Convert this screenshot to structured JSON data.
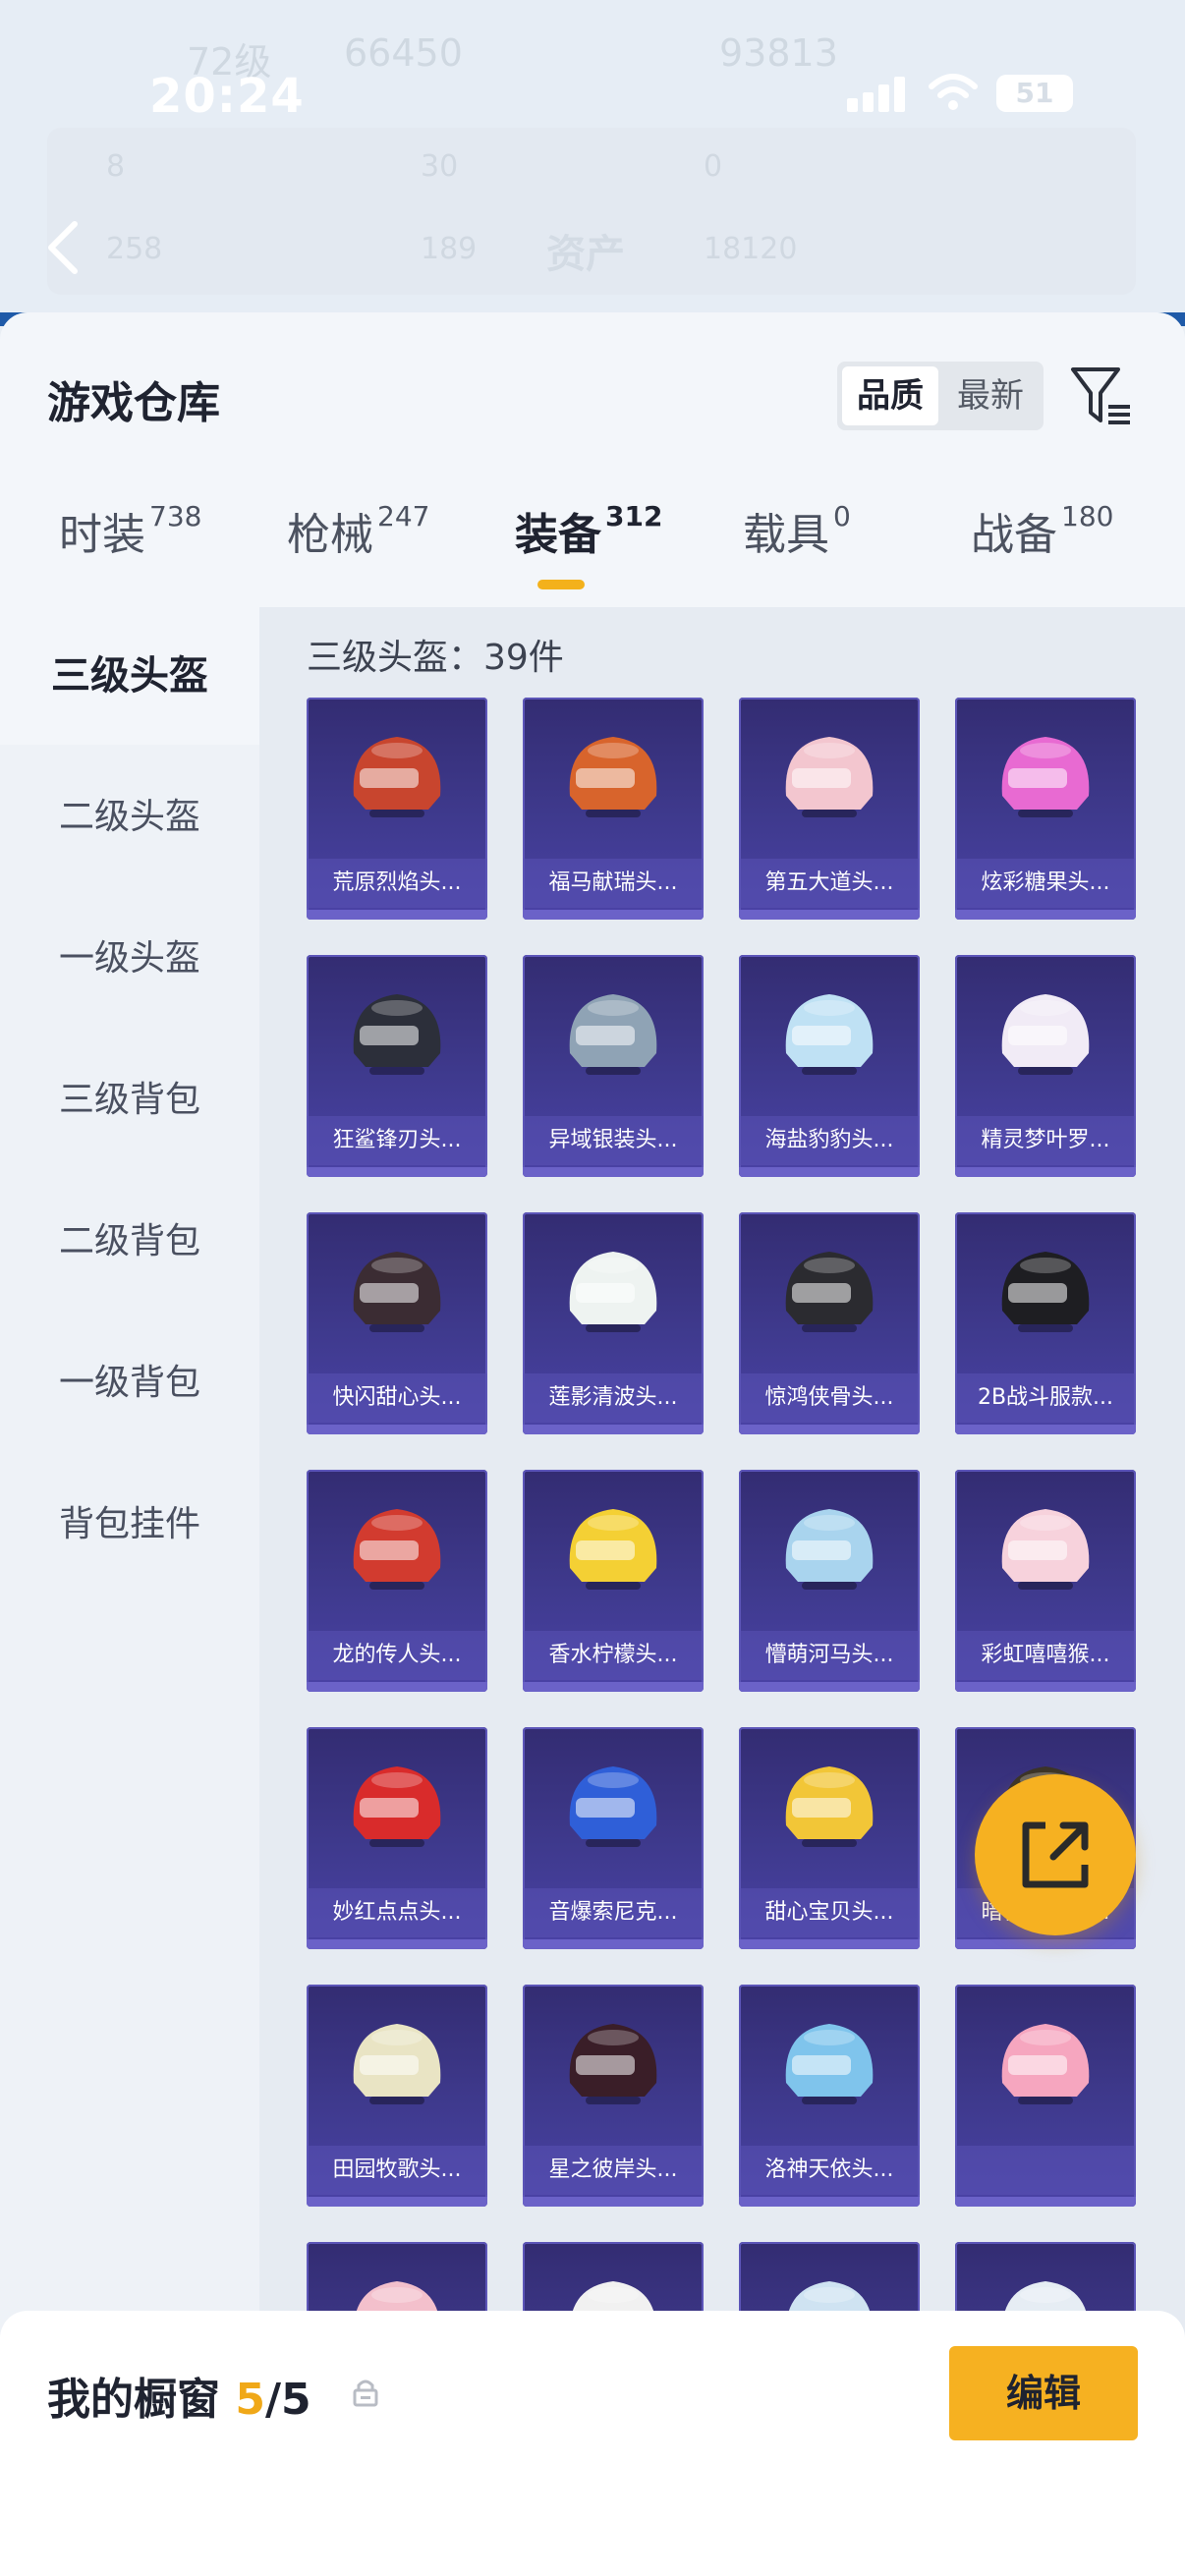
{
  "status_bar": {
    "time": "20:24",
    "battery": "51"
  },
  "background_header": {
    "level": "72级",
    "coins": "66450",
    "right_value": "93813",
    "stats_row1": [
      "8",
      "30",
      "0"
    ],
    "stats_row2": [
      "258",
      "189",
      "18120"
    ],
    "title": "资产"
  },
  "warehouse": {
    "title": "游戏仓库",
    "sort_options": [
      "品质",
      "最新"
    ],
    "tabs": [
      {
        "label": "时装",
        "count": "738"
      },
      {
        "label": "枪械",
        "count": "247"
      },
      {
        "label": "装备",
        "count": "312"
      },
      {
        "label": "载具",
        "count": "0"
      },
      {
        "label": "战备",
        "count": "180"
      }
    ],
    "sidebar": [
      "三级头盔",
      "二级头盔",
      "一级头盔",
      "三级背包",
      "二级背包",
      "一级背包",
      "背包挂件"
    ],
    "count_label": "三级头盔：39件",
    "items": [
      {
        "name": "荒原烈焰头...",
        "color": "#c8452e"
      },
      {
        "name": "福马献瑞头...",
        "color": "#d8642c"
      },
      {
        "name": "第五大道头...",
        "color": "#f3c6cf"
      },
      {
        "name": "炫彩糖果头...",
        "color": "#e86ad2"
      },
      {
        "name": "狂鲨锋刃头...",
        "color": "#2c2f3a"
      },
      {
        "name": "异域银装头...",
        "color": "#8fa3b5"
      },
      {
        "name": "海盐豹豹头...",
        "color": "#bfe1f4"
      },
      {
        "name": "精灵梦叶罗...",
        "color": "#f1ebf6"
      },
      {
        "name": "快闪甜心头...",
        "color": "#3b2c33"
      },
      {
        "name": "莲影清波头...",
        "color": "#eef3f1"
      },
      {
        "name": "惊鸿侠骨头...",
        "color": "#2b2b30"
      },
      {
        "name": "2B战斗服款...",
        "color": "#1e1e22"
      },
      {
        "name": "龙的传人头...",
        "color": "#d23b2f"
      },
      {
        "name": "香水柠檬头...",
        "color": "#f4d034"
      },
      {
        "name": "懵萌河马头...",
        "color": "#a9d4ee"
      },
      {
        "name": "彩虹嘻嘻猴...",
        "color": "#f7d2dc"
      },
      {
        "name": "妙红点点头...",
        "color": "#d92b2b"
      },
      {
        "name": "音爆索尼克...",
        "color": "#2f5fd8"
      },
      {
        "name": "甜心宝贝头...",
        "color": "#f2c637"
      },
      {
        "name": "暗夜鎏金头...",
        "color": "#3a3328"
      },
      {
        "name": "田园牧歌头...",
        "color": "#e9e4c4"
      },
      {
        "name": "星之彼岸头...",
        "color": "#3a1e28"
      },
      {
        "name": "洛神天依头...",
        "color": "#7fc4ec"
      },
      {
        "name": "",
        "color": "#f6a6bf"
      },
      {
        "name": "",
        "color": "#f3c0cc"
      },
      {
        "name": "",
        "color": "#f1f1f1"
      },
      {
        "name": "",
        "color": "#cfe3f2"
      },
      {
        "name": "",
        "color": "#e6edf4"
      }
    ]
  },
  "showcase": {
    "label": "我的橱窗",
    "current": "5",
    "total": "/5",
    "edit_label": "编辑"
  }
}
